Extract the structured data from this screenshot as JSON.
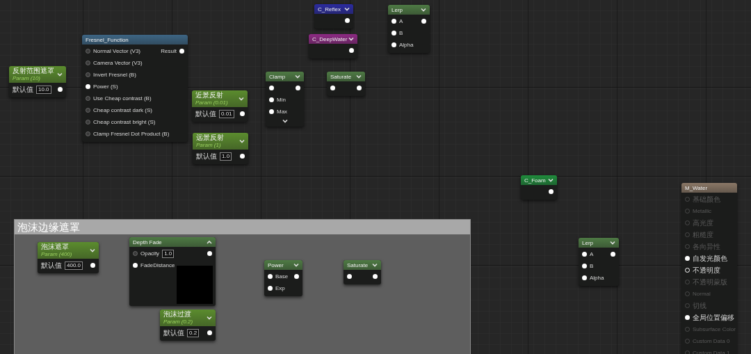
{
  "comment": {
    "title": "泡沫边缘遮罩"
  },
  "nodes": [
    {
      "kind": "param",
      "title": "反射范围遮罩",
      "subtitle": "Param (10)",
      "color": "#5b8c2e",
      "expanded": false,
      "rows": [
        {
          "field": {
            "label": "默认值",
            "value": "10.0"
          },
          "out": {
            "connected": true
          }
        }
      ]
    },
    {
      "kind": "function",
      "title": "Fresnel_Function",
      "color": "#3d6584",
      "rows": [
        {
          "in": {
            "label": "Normal Vector (V3)",
            "connected": false
          },
          "out": {
            "label": "Result",
            "connected": true
          }
        },
        {
          "in": {
            "label": "Camera Vector (V3)",
            "connected": false
          }
        },
        {
          "in": {
            "label": "Invert Fresnel (B)",
            "connected": false
          }
        },
        {
          "in": {
            "label": "Power (S)",
            "connected": true
          }
        },
        {
          "in": {
            "label": "Use Cheap contrast (B)",
            "connected": false
          }
        },
        {
          "in": {
            "label": "Cheap contrast dark (S)",
            "connected": false
          }
        },
        {
          "in": {
            "label": "Cheap contrast bright (S)",
            "connected": false
          }
        },
        {
          "in": {
            "label": "Clamp Fresnel Dot Product (B)",
            "connected": false
          }
        }
      ]
    },
    {
      "kind": "math",
      "title": "Clamp",
      "color": "#4e7a44",
      "expanded": false,
      "more_pins": true,
      "rows": [
        {
          "in": {
            "connected": true
          },
          "out": {
            "connected": true
          }
        },
        {
          "in": {
            "label": "Min",
            "connected": true
          }
        },
        {
          "in": {
            "label": "Max",
            "connected": true
          }
        }
      ]
    },
    {
      "kind": "param",
      "title": "近景反射",
      "subtitle": "Param (0.01)",
      "color": "#5b8c2e",
      "expanded": false,
      "rows": [
        {
          "field": {
            "label": "默认值",
            "value": "0.01"
          },
          "out": {
            "connected": true
          }
        }
      ]
    },
    {
      "kind": "param",
      "title": "远景反射",
      "subtitle": "Param (1)",
      "color": "#5b8c2e",
      "expanded": false,
      "rows": [
        {
          "field": {
            "label": "默认值",
            "value": "1.0"
          },
          "out": {
            "connected": true
          }
        }
      ]
    },
    {
      "kind": "math",
      "title": "Saturate",
      "color": "#4e7a44",
      "expanded": false,
      "rows": [
        {
          "in": {
            "connected": true
          },
          "out": {
            "connected": true
          }
        }
      ]
    },
    {
      "kind": "constant",
      "title": "C_Reflex",
      "color": "#2b2ba0",
      "expanded": false,
      "rows": [
        {
          "out": {
            "connected": true
          }
        }
      ]
    },
    {
      "kind": "constant",
      "title": "C_DeepWater",
      "color": "#8e2a84",
      "expanded": false,
      "rows": [
        {
          "out": {
            "connected": true
          }
        }
      ]
    },
    {
      "kind": "math",
      "title": "Lerp",
      "color": "#4e7a44",
      "expanded": false,
      "rows": [
        {
          "in": {
            "label": "A",
            "connected": true
          },
          "out": {
            "connected": true
          }
        },
        {
          "in": {
            "label": "B",
            "connected": true
          }
        },
        {
          "in": {
            "label": "Alpha",
            "connected": true
          }
        }
      ]
    },
    {
      "kind": "constant",
      "title": "C_Foam",
      "color": "#1f8c3c",
      "expanded": false,
      "rows": [
        {
          "out": {
            "connected": true
          }
        }
      ]
    },
    {
      "kind": "math",
      "title": "Lerp",
      "color": "#4e7a44",
      "expanded": false,
      "rows": [
        {
          "in": {
            "label": "A",
            "connected": true
          },
          "out": {
            "connected": true
          }
        },
        {
          "in": {
            "label": "B",
            "connected": true
          }
        },
        {
          "in": {
            "label": "Alpha",
            "connected": true
          }
        }
      ]
    },
    {
      "kind": "result",
      "title": "M_Water",
      "color": "#8a7766",
      "rows": [
        {
          "in": {
            "label": "基础颜色",
            "connected": false,
            "disabled": true
          }
        },
        {
          "in": {
            "label": "Metallic",
            "connected": false,
            "disabled": true
          }
        },
        {
          "in": {
            "label": "高光度",
            "connected": false,
            "disabled": true
          }
        },
        {
          "in": {
            "label": "粗糙度",
            "connected": false,
            "disabled": true
          }
        },
        {
          "in": {
            "label": "各向异性",
            "connected": false,
            "disabled": true
          }
        },
        {
          "in": {
            "label": "自发光颜色",
            "connected": true,
            "disabled": false
          }
        },
        {
          "in": {
            "label": "不透明度",
            "connected": false,
            "disabled": false
          }
        },
        {
          "in": {
            "label": "不透明蒙版",
            "connected": false,
            "disabled": true
          }
        },
        {
          "in": {
            "label": "Normal",
            "connected": false,
            "disabled": true
          }
        },
        {
          "in": {
            "label": "切线",
            "connected": false,
            "disabled": true
          }
        },
        {
          "in": {
            "label": "全局位置偏移",
            "connected": true,
            "disabled": false
          }
        },
        {
          "in": {
            "label": "Subsurface Color",
            "connected": false,
            "disabled": true
          }
        },
        {
          "in": {
            "label": "Custom Data 0",
            "connected": false,
            "disabled": true
          }
        },
        {
          "in": {
            "label": "Custom Data 1",
            "connected": false,
            "disabled": true
          }
        }
      ]
    },
    {
      "kind": "param",
      "title": "泡沫遮罩",
      "subtitle": "Param (400)",
      "color": "#5b8c2e",
      "expanded": false,
      "rows": [
        {
          "field": {
            "label": "默认值",
            "value": "400.0"
          },
          "out": {
            "connected": true
          }
        }
      ]
    },
    {
      "kind": "math",
      "title": "Depth Fade",
      "color": "#4e7a44",
      "expanded": true,
      "preview": true,
      "rows": [
        {
          "in": {
            "label": "Opacity",
            "connected": false
          },
          "field": {
            "value": "1.0"
          },
          "out": {
            "connected": true
          }
        },
        {
          "in": {
            "label": "FadeDistance",
            "connected": true
          }
        }
      ]
    },
    {
      "kind": "math",
      "title": "Power",
      "color": "#4e7a44",
      "expanded": false,
      "rows": [
        {
          "in": {
            "label": "Base",
            "connected": true
          },
          "out": {
            "connected": true
          }
        },
        {
          "in": {
            "label": "Exp",
            "connected": true
          }
        }
      ]
    },
    {
      "kind": "math",
      "title": "Saturate",
      "color": "#4e7a44",
      "expanded": false,
      "rows": [
        {
          "in": {
            "connected": true
          },
          "out": {
            "connected": true
          }
        }
      ]
    },
    {
      "kind": "param",
      "title": "泡沫过渡",
      "subtitle": "Param (0.2)",
      "color": "#5b8c2e",
      "expanded": false,
      "rows": [
        {
          "field": {
            "label": "默认值",
            "value": "0.2"
          },
          "out": {
            "connected": true
          }
        }
      ]
    }
  ]
}
